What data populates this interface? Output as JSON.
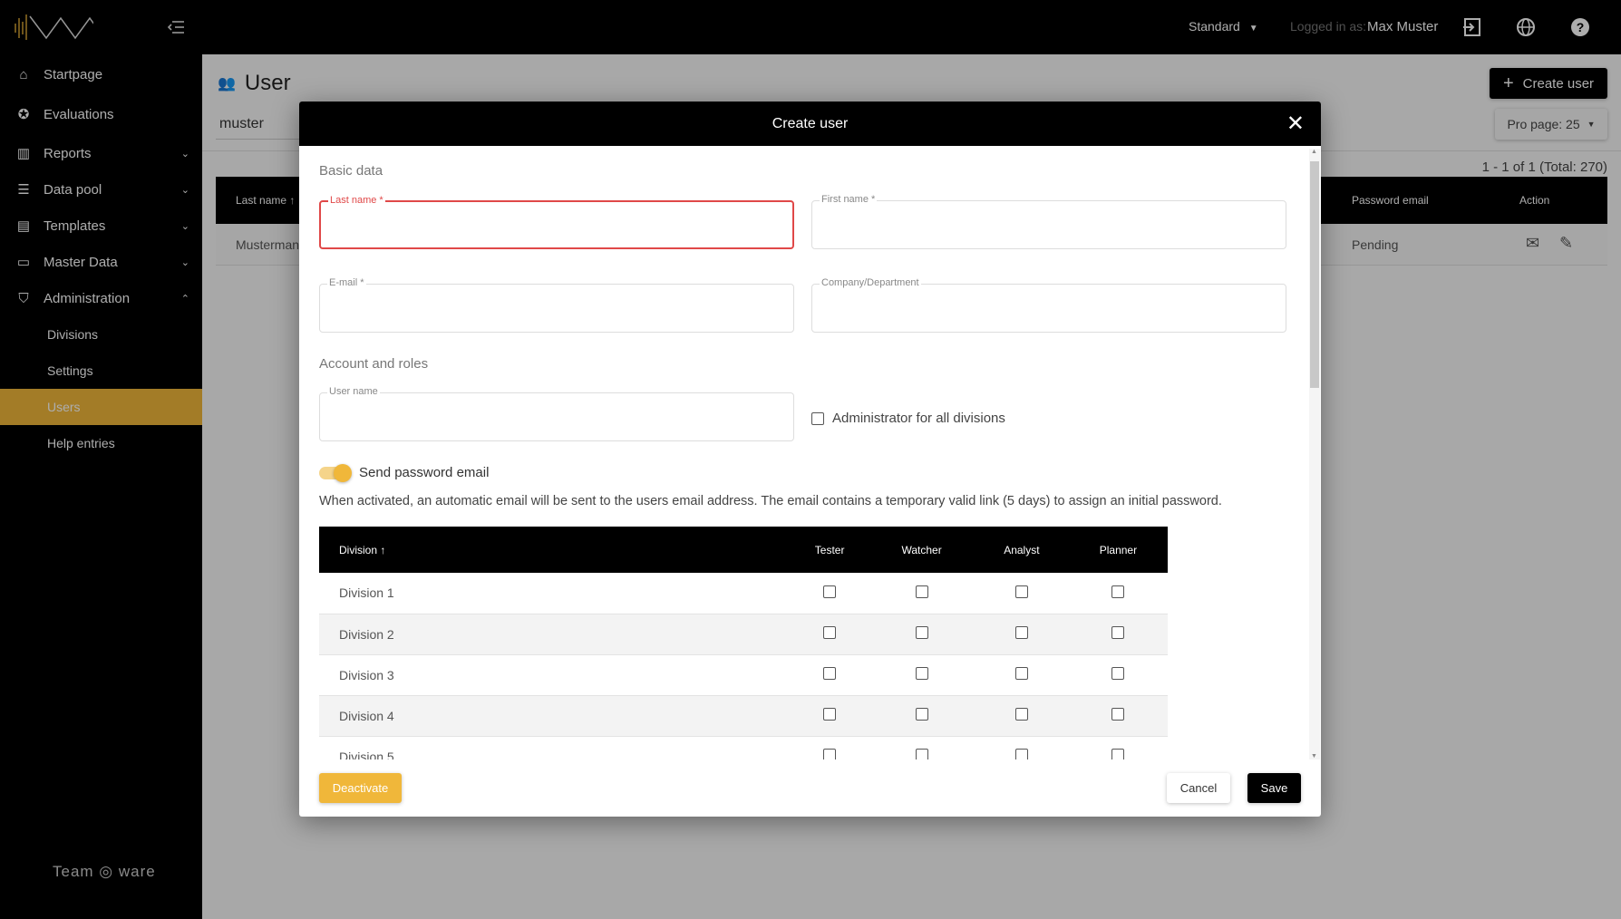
{
  "header": {
    "view_mode": "Standard",
    "logged_in_label": "Logged in as:",
    "user_name": "Max Muster",
    "icons": [
      "logout-icon",
      "globe-icon",
      "help-icon"
    ]
  },
  "sidebar": {
    "items": [
      {
        "label": "Startpage",
        "icon": "home-icon",
        "expandable": false
      },
      {
        "label": "Evaluations",
        "icon": "star-icon",
        "expandable": false
      },
      {
        "label": "Reports",
        "icon": "bar-chart-icon",
        "expandable": true
      },
      {
        "label": "Data pool",
        "icon": "database-icon",
        "expandable": true
      },
      {
        "label": "Templates",
        "icon": "template-icon",
        "expandable": true
      },
      {
        "label": "Master Data",
        "icon": "inbox-icon",
        "expandable": true
      },
      {
        "label": "Administration",
        "icon": "shield-icon",
        "expandable": true,
        "expanded": true
      }
    ],
    "sub_items": [
      {
        "label": "Divisions"
      },
      {
        "label": "Settings"
      },
      {
        "label": "Users",
        "active": true
      },
      {
        "label": "Help entries"
      }
    ],
    "brand": "Team ware"
  },
  "page": {
    "title": "User",
    "search_value": "muster",
    "create_button": "Create user",
    "per_page": "Pro page: 25",
    "pagination": "1 - 1 of 1 (Total: 270)",
    "columns": [
      "Last name",
      "Password email",
      "Action"
    ],
    "row": {
      "last_name": "Musterman",
      "password_email": "Pending"
    }
  },
  "modal": {
    "title": "Create user",
    "basic_section": "Basic data",
    "fields": {
      "last_name": "Last name *",
      "first_name": "First name *",
      "email": "E-mail *",
      "company": "Company/Department",
      "username": "User name"
    },
    "account_section": "Account and roles",
    "admin_all_label": "Administrator for all divisions",
    "send_email_label": "Send password email",
    "send_email_on": true,
    "description": "When activated, an automatic email will be sent to the users email address. The email contains a temporary valid link (5 days) to assign an initial password.",
    "table": {
      "columns": [
        "Division",
        "Tester",
        "Watcher",
        "Analyst",
        "Planner"
      ],
      "rows": [
        "Division 1",
        "Division 2",
        "Division 3",
        "Division 4",
        "Division 5"
      ]
    },
    "deactivate": "Deactivate",
    "cancel": "Cancel",
    "save": "Save"
  },
  "colors": {
    "accent": "#f0b73a",
    "error": "#e04848",
    "header": "#000000"
  }
}
